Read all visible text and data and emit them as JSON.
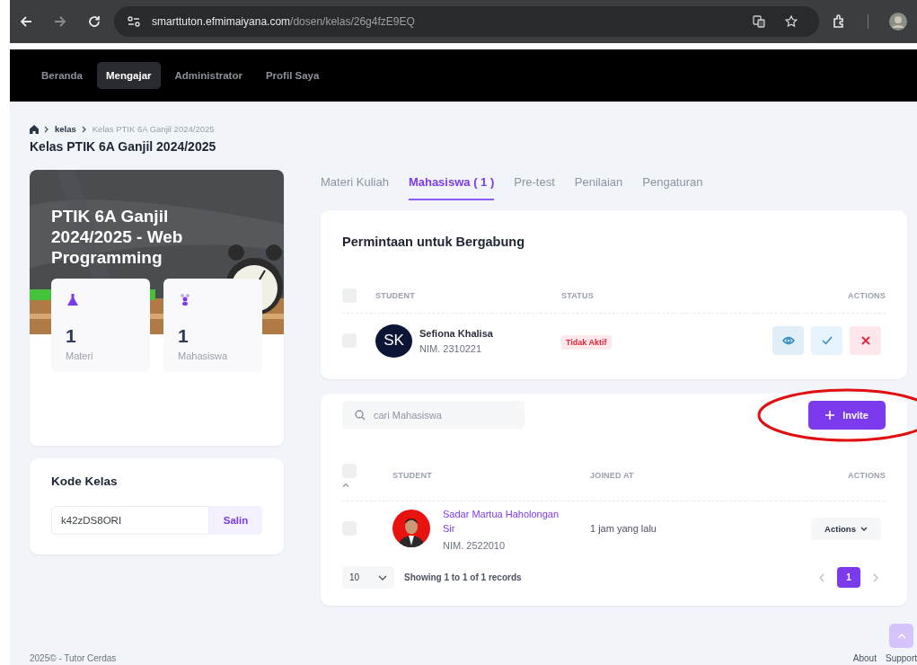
{
  "browser": {
    "url_host": "smarttuton.efmimaiyana.com",
    "url_path": "/dosen/kelas/26g4fzE9EQ"
  },
  "nav": [
    {
      "label": "Beranda",
      "selected": false
    },
    {
      "label": "Mengajar",
      "selected": true
    },
    {
      "label": "Administrator",
      "selected": false
    },
    {
      "label": "Profil Saya",
      "selected": false
    }
  ],
  "breadcrumb": [
    "kelas",
    "Kelas PTIK 6A Ganjil 2024/2025"
  ],
  "page_title": "Kelas PTIK 6A Ganjil 2024/2025",
  "course_card": {
    "title": "PTIK 6A Ganjil 2024/2025 - Web Programming",
    "stats": [
      {
        "kind": "materi",
        "value": "1",
        "label": "Materi"
      },
      {
        "kind": "mahasiswa",
        "value": "1",
        "label": "Mahasiswa"
      }
    ]
  },
  "class_code": {
    "title": "Kode Kelas",
    "code": "k42zDS8ORI",
    "copy_button": "Salin"
  },
  "tabs": [
    {
      "label": "Materi Kuliah",
      "selected": false
    },
    {
      "label": "Mahasiswa ( 1 )",
      "selected": true
    },
    {
      "label": "Pre-test",
      "selected": false
    },
    {
      "label": "Penilaian",
      "selected": false
    },
    {
      "label": "Pengaturan",
      "selected": false
    }
  ],
  "requests": {
    "title": "Permintaan untuk Bergabung",
    "select_all_checked": false,
    "columns": [
      "STUDENT",
      "STATUS",
      "ACTIONS"
    ],
    "rows": [
      {
        "checked": false,
        "initials": "SK",
        "name": "Sefiona Khalisa",
        "nim": "NIM. 2310221",
        "status": "Tidak Aktif"
      }
    ]
  },
  "students": {
    "search_placeholder": "cari Mahasiswa",
    "invite_button": "Invite",
    "select_all_checked": false,
    "columns": [
      "STUDENT",
      "JOINED AT",
      "ACTIONS"
    ],
    "rows": [
      {
        "checked": false,
        "name": "Sadar Martua Haholongan Sir",
        "nim": "NIM. 2522010",
        "joined": "1 jam yang lalu",
        "actions": "Actions"
      }
    ],
    "page_size": "10",
    "summary": "Showing 1 to 1 of 1 records",
    "pages": [
      {
        "label": "1",
        "selected": true
      }
    ]
  },
  "footer": {
    "copyright": "2025©  - Tutor Cerdas",
    "links": [
      "About",
      "Support"
    ]
  }
}
